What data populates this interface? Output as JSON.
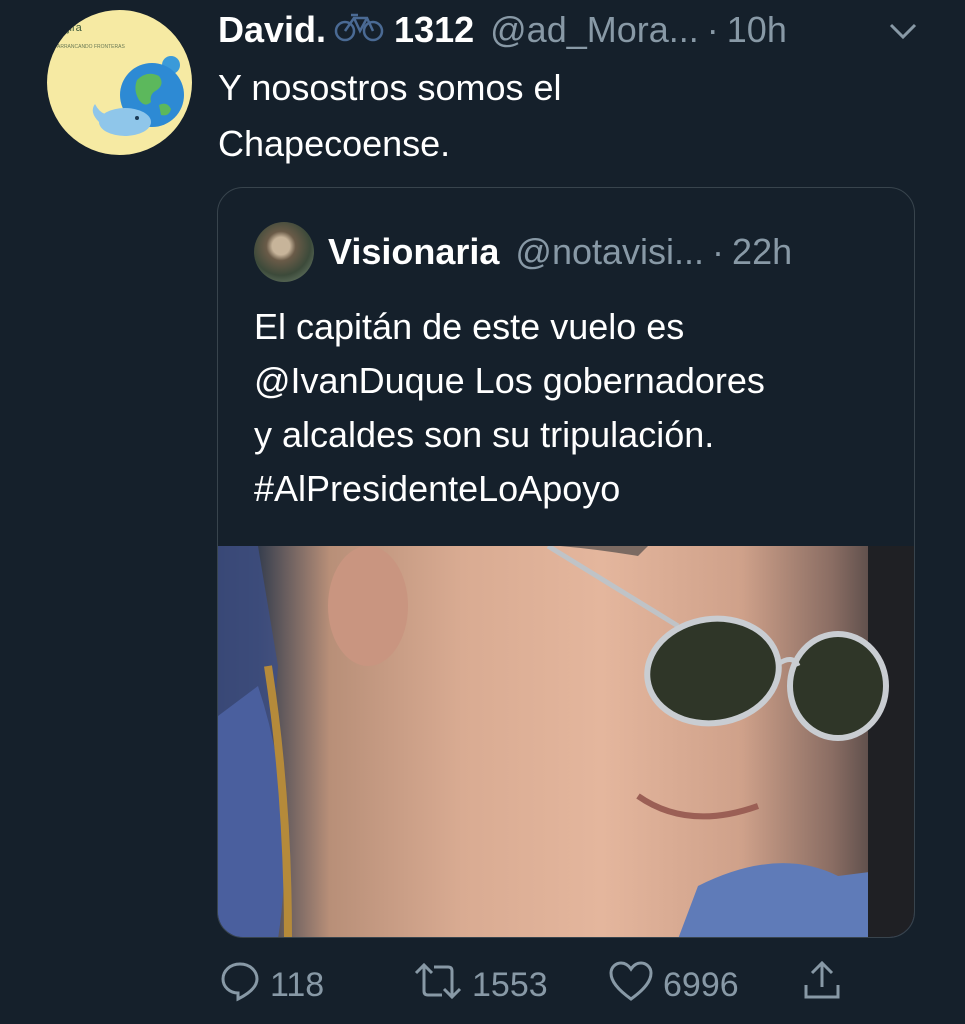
{
  "tweet": {
    "author_name": "David.",
    "author_suffix": "1312",
    "handle": "@ad_Mora...",
    "separator": "·",
    "time": "10h",
    "text_line1": "Y nosostros somos el",
    "text_line2": "Chapecoense.",
    "avatar_text": "ajira",
    "avatar_subtext": "ARRANCANDO FRONTERAS"
  },
  "quoted": {
    "name": "Visionaria",
    "handle": "@notavisi...",
    "separator": "·",
    "time": "22h",
    "lines": [
      "El capitán de este vuelo es",
      "@IvanDuque Los gobernadores",
      "y alcaldes son su tripulación.",
      "#AlPresidenteLoApoyo"
    ]
  },
  "actions": {
    "reply_count": "118",
    "retweet_count": "1553",
    "like_count": "6996"
  },
  "colors": {
    "background": "#15202b",
    "secondary_text": "#8899a6",
    "border": "#38444d"
  },
  "icons": [
    "bicycle-icon",
    "chevron-down-icon",
    "reply-icon",
    "retweet-icon",
    "like-icon",
    "share-icon"
  ]
}
